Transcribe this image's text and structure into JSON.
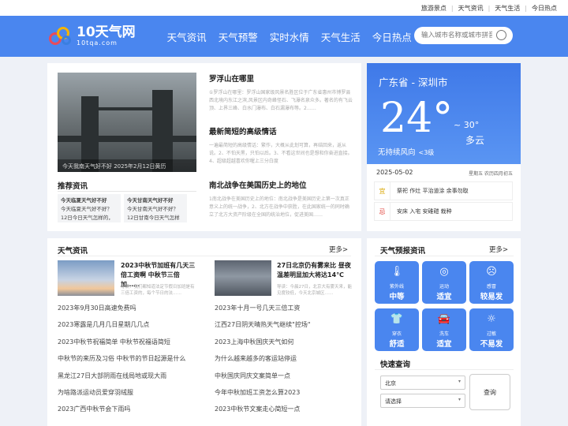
{
  "topbar": {
    "links": [
      "旅游景点",
      "天气资讯",
      "天气生活",
      "今日热点"
    ]
  },
  "header": {
    "logo_title": "10天气网",
    "logo_domain": "10tqa.com",
    "nav": [
      "天气资讯",
      "天气预警",
      "实时水情",
      "天气生活",
      "今日热点"
    ],
    "search_placeholder": "输入城市名称或城市拼音"
  },
  "feature": {
    "caption": "今天我南天气好不好 2025年2月12日黄历",
    "recommend_title": "推荐资讯",
    "recommend": [
      {
        "title": "今天临夏天气好不好",
        "lines": [
          "今天临夏天气好不好？",
          "12日今日天气怎样的，"
        ]
      },
      {
        "title": "今天甘南天气好不好",
        "lines": [
          "今天甘南天气好不好？",
          "12日甘南今日天气怎样"
        ]
      }
    ]
  },
  "articles": [
    {
      "title": "罗浮山在哪里",
      "excerpt": "①罗浮山在哪里：罗浮山国家级风景名胜区位于广东省惠州市博罗县西北境内东江之滨,风景区内奇峰怪石、飞瀑名泉众多。著名的有飞云顶、上界三峰、白水门瀑布、白石漏瀑布等。2……"
    },
    {
      "title": "最新简短的高级情话",
      "excerpt": "一遍最简短的高级情话：繁作，大概从此划可算，再结回来，返从说。2、不怕天黑，只怕以后。3、不看这世间也是想和你奋进直接。4、超级超越喜欢你喔上三分白度"
    },
    {
      "title": "南北战争在美国历史上的地位",
      "excerpt": "1南北战争在美国历史上的地位：南北战争是美国历史上第一次真正意义上的统一战争，2、北方在战争中获胜，在此国家统一的同时确立了北方大资产阶级在全国的统治地位，促进美国……"
    }
  ],
  "weather": {
    "city": "广东省 - 深圳市",
    "temp": "24°",
    "range": "~ 30°",
    "condition": "多云",
    "wind": "无持续风向",
    "wind_level": "<3级",
    "date": "2025-05-02",
    "lunar": "星期五 农历四月初五",
    "yi_icon": "宜",
    "yi": "祭祀 作灶 平治道涂 余事勿取",
    "ji_icon": "忌",
    "ji": "安床 入宅 安碓磑 栽种"
  },
  "news": {
    "title": "天气资讯",
    "more": "更多>",
    "featured": [
      {
        "title": "2023中秋节加班有几天三倍工资啊 中秋节三倍加……",
        "desc": "导读：我们都知道法定节假日加班是有三倍工资的，每个节日的法……"
      },
      {
        "title": "27日北京仍有雾来比 昼夜温差明显加大将达14℃",
        "desc": "导读：今晨27日，北京大有雾天来，能见度较低，今天北京城区……"
      }
    ],
    "left_list": [
      "2023年9月30日高速免费吗",
      "2023寒露是几月几日星期几几点",
      "2023中秋节祝福简单 中秋节祝福语简短",
      "中秋节的来历及习俗 中秋节的节日起源是什么",
      "黑龙江27日大部阴雨在线局地或现大雨",
      "为啥路派运动员爱穿羽绒服",
      "2023广西中秋节会下雨吗"
    ],
    "right_list": [
      "2023年十月一号几天三倍工资",
      "江西27日阴天晴热天气继续\"控场\"",
      "2023上海中秋国庆天气如何",
      "为什么越来越多的客运站停运",
      "中秋国庆同庆文案简单一点",
      "今年中秋加班工资怎么算2023",
      "2023中秋节文案走心简短一点"
    ]
  },
  "forecast": {
    "title": "天气预报资讯",
    "more": "更多>",
    "items": [
      {
        "icon": "thermometer-icon",
        "glyph": "🌡",
        "label": "紫外线",
        "value": "中等"
      },
      {
        "icon": "ball-icon",
        "glyph": "◎",
        "label": "运动",
        "value": "适宜"
      },
      {
        "icon": "cold-icon",
        "glyph": "☹",
        "label": "感冒",
        "value": "较易发"
      },
      {
        "icon": "clothes-icon",
        "glyph": "👕",
        "label": "穿衣",
        "value": "舒适"
      },
      {
        "icon": "car-icon",
        "glyph": "🚘",
        "label": "洗车",
        "value": "适宜"
      },
      {
        "icon": "sun-icon",
        "glyph": "☼",
        "label": "过敏",
        "value": "不易发"
      }
    ],
    "query_title": "快速查询",
    "province": "北京",
    "city_placeholder": "请选择",
    "query_button": "查询"
  }
}
